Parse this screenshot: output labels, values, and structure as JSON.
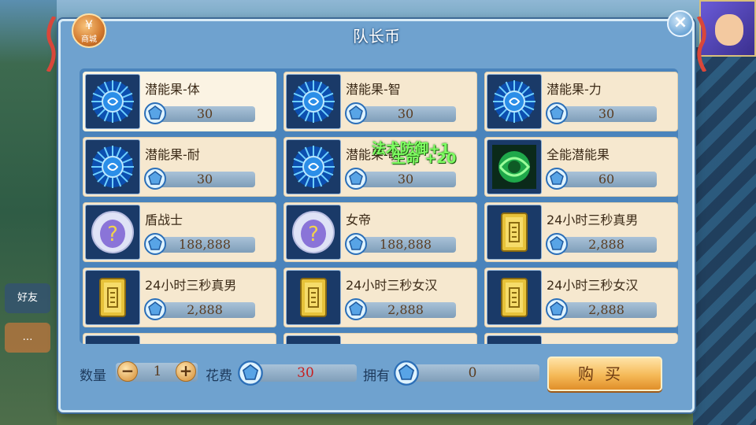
{
  "title": "队长币",
  "shop_badge": {
    "glyph": "¥",
    "label": "商城"
  },
  "close_glyph": "×",
  "background": {
    "friend_label": "好友"
  },
  "floating_text": {
    "line1": "法术防御+1",
    "line2": "生命 +20"
  },
  "items": [
    {
      "name": "潜能果-体",
      "price": "30",
      "icon": "potential-fruit-blue-icon",
      "selected": true
    },
    {
      "name": "潜能果-智",
      "price": "30",
      "icon": "potential-fruit-blue-icon",
      "selected": false
    },
    {
      "name": "潜能果-力",
      "price": "30",
      "icon": "potential-fruit-blue-icon",
      "selected": false
    },
    {
      "name": "潜能果-耐",
      "price": "30",
      "icon": "potential-fruit-blue-icon",
      "selected": false
    },
    {
      "name": "潜能果-敏",
      "price": "30",
      "icon": "potential-fruit-blue-icon",
      "selected": false
    },
    {
      "name": "全能潜能果",
      "price": "60",
      "icon": "potential-fruit-green-icon",
      "selected": false
    },
    {
      "name": "盾战士",
      "price": "188,888",
      "icon": "mystery-egg-icon",
      "selected": false
    },
    {
      "name": "女帝",
      "price": "188,888",
      "icon": "mystery-egg-icon",
      "selected": false
    },
    {
      "name": "24小时三秒真男",
      "price": "2,888",
      "icon": "gold-card-icon",
      "selected": false
    },
    {
      "name": "24小时三秒真男",
      "price": "2,888",
      "icon": "gold-card-icon",
      "selected": false
    },
    {
      "name": "24小时三秒女汉",
      "price": "2,888",
      "icon": "gold-card-icon",
      "selected": false
    },
    {
      "name": "24小时三秒女汉",
      "price": "2,888",
      "icon": "gold-card-icon",
      "selected": false
    }
  ],
  "bottom": {
    "qty_label": "数量",
    "minus": "−",
    "qty": "1",
    "plus": "+",
    "cost_label": "花费",
    "cost": "30",
    "own_label": "拥有",
    "own": "0",
    "buy_label": "购买"
  },
  "colors": {
    "panel": "#6fa2cf",
    "card": "#f6e8cf",
    "cost_text": "#c81e1e",
    "buy_button": "#f5b957"
  }
}
